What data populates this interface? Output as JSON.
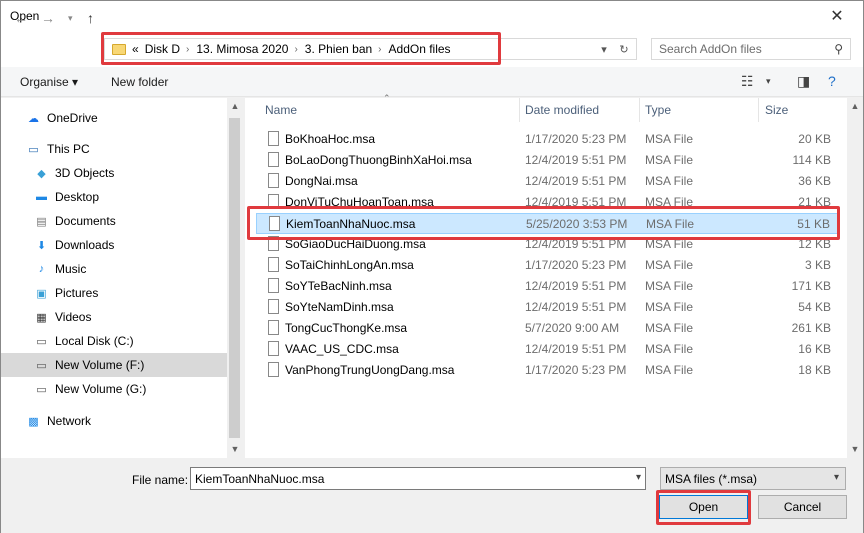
{
  "window": {
    "title": "Open"
  },
  "nav": {
    "breadcrumb": [
      "Disk D",
      "13. Mimosa 2020",
      "3. Phien ban",
      "AddOn files"
    ],
    "overflow": "«",
    "search_placeholder": "Search AddOn files"
  },
  "toolbar": {
    "organise": "Organise",
    "new_folder": "New folder"
  },
  "sidebar": {
    "items": [
      {
        "label": "OneDrive",
        "icon": "cloud-icon",
        "color": "#1a73e8"
      },
      {
        "label": "This PC",
        "icon": "computer-icon",
        "color": "#2b6cb0"
      },
      {
        "label": "3D Objects",
        "icon": "cube-icon",
        "color": "#39a0d6"
      },
      {
        "label": "Desktop",
        "icon": "desktop-icon",
        "color": "#1e88e5"
      },
      {
        "label": "Documents",
        "icon": "document-icon",
        "color": "#777"
      },
      {
        "label": "Downloads",
        "icon": "download-icon",
        "color": "#1e88e5"
      },
      {
        "label": "Music",
        "icon": "music-icon",
        "color": "#1e88e5"
      },
      {
        "label": "Pictures",
        "icon": "picture-icon",
        "color": "#3aa0d6"
      },
      {
        "label": "Videos",
        "icon": "video-icon",
        "color": "#333"
      },
      {
        "label": "Local Disk (C:)",
        "icon": "drive-icon",
        "color": "#555"
      },
      {
        "label": "New Volume (F:)",
        "icon": "drive-icon",
        "color": "#555"
      },
      {
        "label": "New Volume (G:)",
        "icon": "drive-icon",
        "color": "#555"
      },
      {
        "label": "Network",
        "icon": "network-icon",
        "color": "#1e88e5"
      }
    ]
  },
  "columns": {
    "name": "Name",
    "date": "Date modified",
    "type": "Type",
    "size": "Size"
  },
  "files": [
    {
      "name": "BoKhoaHoc.msa",
      "date": "1/17/2020 5:23 PM",
      "type": "MSA File",
      "size": "20 KB"
    },
    {
      "name": "BoLaoDongThuongBinhXaHoi.msa",
      "date": "12/4/2019 5:51 PM",
      "type": "MSA File",
      "size": "114 KB"
    },
    {
      "name": "DongNai.msa",
      "date": "12/4/2019 5:51 PM",
      "type": "MSA File",
      "size": "36 KB"
    },
    {
      "name": "DonViTuChuHoanToan.msa",
      "date": "12/4/2019 5:51 PM",
      "type": "MSA File",
      "size": "21 KB"
    },
    {
      "name": "KiemToanNhaNuoc.msa",
      "date": "5/25/2020 3:53 PM",
      "type": "MSA File",
      "size": "51 KB"
    },
    {
      "name": "SoGiaoDucHaiDuong.msa",
      "date": "12/4/2019 5:51 PM",
      "type": "MSA File",
      "size": "12 KB"
    },
    {
      "name": "SoTaiChinhLongAn.msa",
      "date": "1/17/2020 5:23 PM",
      "type": "MSA File",
      "size": "3 KB"
    },
    {
      "name": "SoYTeBacNinh.msa",
      "date": "12/4/2019 5:51 PM",
      "type": "MSA File",
      "size": "171 KB"
    },
    {
      "name": "SoYteNamDinh.msa",
      "date": "12/4/2019 5:51 PM",
      "type": "MSA File",
      "size": "54 KB"
    },
    {
      "name": "TongCucThongKe.msa",
      "date": "5/7/2020 9:00 AM",
      "type": "MSA File",
      "size": "261 KB"
    },
    {
      "name": "VAAC_US_CDC.msa",
      "date": "12/4/2019 5:51 PM",
      "type": "MSA File",
      "size": "16 KB"
    },
    {
      "name": "VanPhongTrungUongDang.msa",
      "date": "1/17/2020 5:23 PM",
      "type": "MSA File",
      "size": "18 KB"
    }
  ],
  "bottom": {
    "file_name_label": "File name:",
    "file_name_value": "KiemToanNhaNuoc.msa",
    "filter_value": "MSA files (*.msa)",
    "open_label": "Open",
    "cancel_label": "Cancel"
  },
  "colors": {
    "highlight": "#e03a3e",
    "selection": "#cce8ff"
  }
}
